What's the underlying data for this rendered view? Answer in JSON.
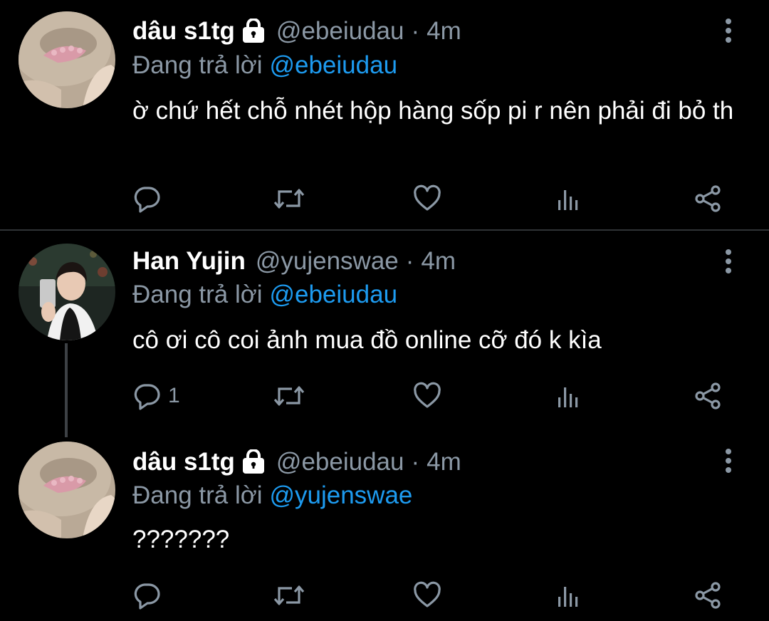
{
  "colors": {
    "background": "#000000",
    "text": "#ffffff",
    "muted": "#8b98a5",
    "mention": "#1d9bf0",
    "divider": "#2f3336"
  },
  "tweets": [
    {
      "display_name": "dâu s1tg",
      "protected": true,
      "handle": "@ebeiudau",
      "separator": "·",
      "time": "4m",
      "reply_prefix": "Đang trả lời",
      "reply_to": "@ebeiudau",
      "text": "ờ chứ hết chỗ nhét hộp hàng sốp pi r nên phải đi bỏ th",
      "reply_count": "",
      "avatar": "pink-hairclip-photo"
    },
    {
      "display_name": "Han Yujin",
      "protected": false,
      "handle": "@yujenswae",
      "separator": "·",
      "time": "4m",
      "reply_prefix": "Đang trả lời",
      "reply_to": "@ebeiudau",
      "text": "cô ơi cô coi ảnh mua đồ online cỡ đó k kìa",
      "reply_count": "1",
      "avatar": "mirror-selfie-photo"
    },
    {
      "display_name": "dâu s1tg",
      "protected": true,
      "handle": "@ebeiudau",
      "separator": "·",
      "time": "4m",
      "reply_prefix": "Đang trả lời",
      "reply_to": "@yujenswae",
      "text": "???????",
      "reply_count": "",
      "avatar": "pink-hairclip-photo"
    }
  ],
  "icons": {
    "reply": "reply-icon",
    "retweet": "retweet-icon",
    "like": "like-icon",
    "analytics": "analytics-icon",
    "share": "share-icon",
    "more": "more-vertical-icon",
    "lock": "lock-icon"
  }
}
